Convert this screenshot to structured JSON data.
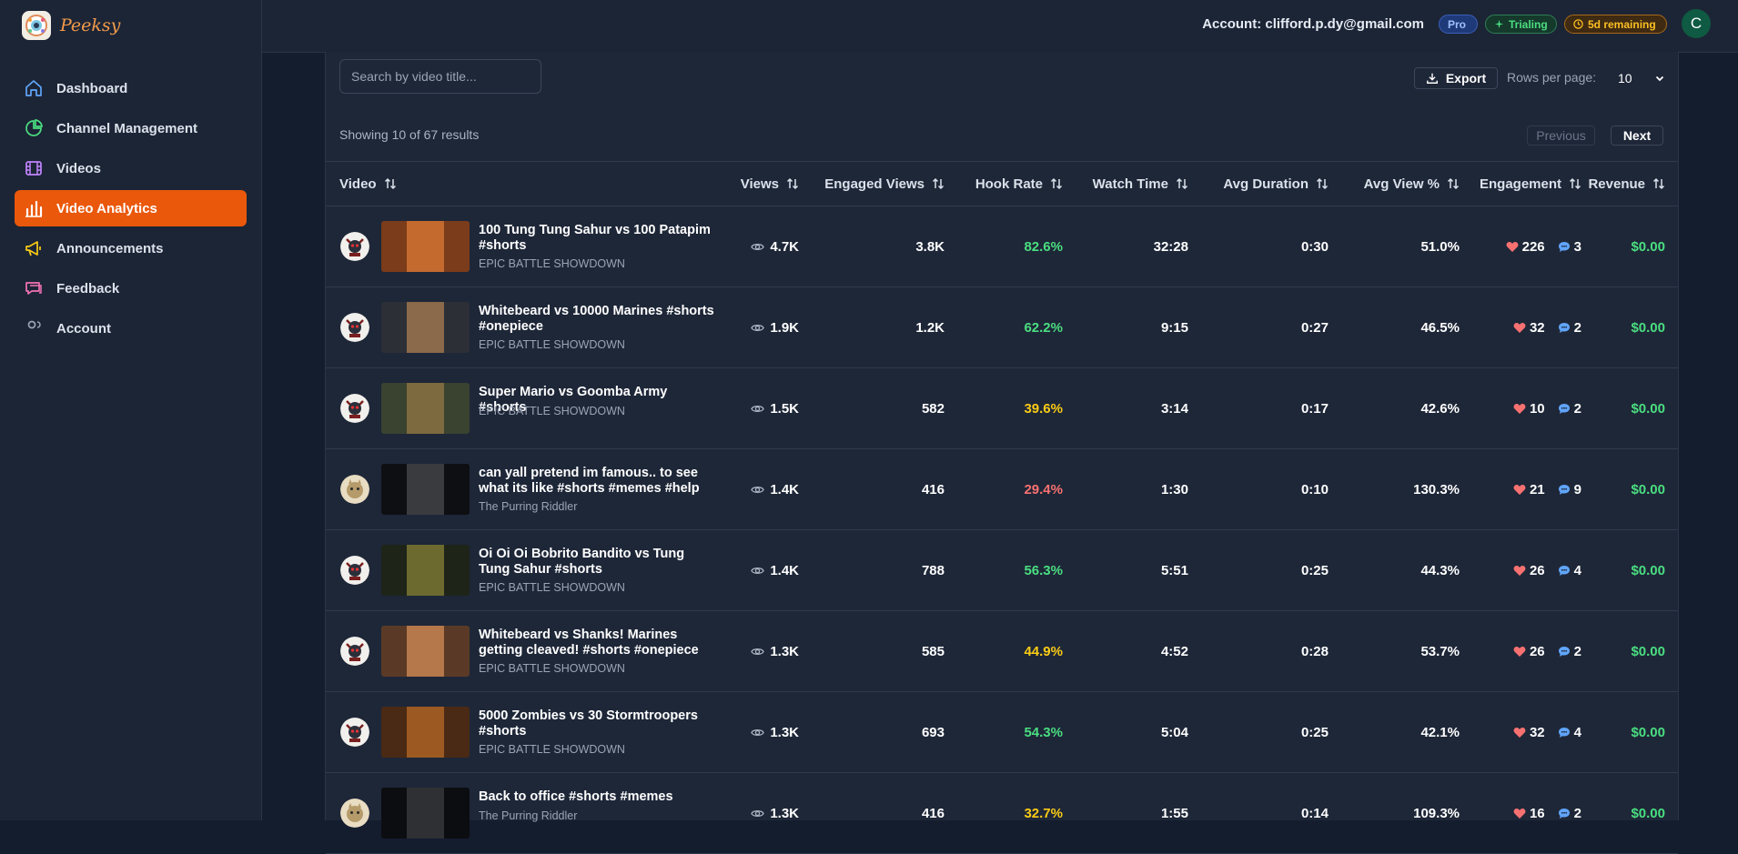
{
  "app": {
    "name": "Peeksy"
  },
  "sidebar": {
    "items": [
      {
        "label": "Dashboard",
        "icon": "home-icon",
        "color": "#60a5fa"
      },
      {
        "label": "Channel Management",
        "icon": "pie-chart-icon",
        "color": "#4ade80"
      },
      {
        "label": "Videos",
        "icon": "film-icon",
        "color": "#c084fc"
      },
      {
        "label": "Video Analytics",
        "icon": "bar-chart-icon",
        "color": "#ffffff",
        "active": true
      },
      {
        "label": "Announcements",
        "icon": "megaphone-icon",
        "color": "#facc15"
      },
      {
        "label": "Feedback",
        "icon": "message-icon",
        "color": "#f472b6"
      },
      {
        "label": "Account",
        "icon": "users-icon",
        "color": "#9aa4b5"
      }
    ]
  },
  "header": {
    "account": "Account: clifford.p.dy@gmail.com",
    "badges": {
      "pro": "Pro",
      "trialing": "Trialing",
      "remaining": "5d remaining"
    },
    "avatar_initial": "C"
  },
  "controls": {
    "search_placeholder": "Search by video title...",
    "export_label": "Export",
    "rows_per_page_label": "Rows per page:",
    "rows_per_page_value": "10",
    "showing": "Showing 10 of 67 results",
    "previous": "Previous",
    "next": "Next"
  },
  "table": {
    "columns": [
      "Video",
      "Views",
      "Engaged Views",
      "Hook Rate",
      "Watch Time",
      "Avg Duration",
      "Avg View %",
      "Engagement",
      "Revenue"
    ],
    "rows": [
      {
        "title": "100 Tung Tung Sahur vs 100 Patapim #shorts",
        "channel": "EPIC BATTLE SHOWDOWN",
        "views": "4.7K",
        "engaged": "3.8K",
        "hook": "82.6%",
        "hook_level": "green",
        "watch": "32:28",
        "avg_dur": "0:30",
        "avg_view": "51.0%",
        "likes": "226",
        "comments": "3",
        "revenue": "$0.00",
        "thumb": [
          "#7a3c1a",
          "#c46a2e"
        ]
      },
      {
        "title": "Whitebeard vs 10000 Marines #shorts #onepiece",
        "channel": "EPIC BATTLE SHOWDOWN",
        "views": "1.9K",
        "engaged": "1.2K",
        "hook": "62.2%",
        "hook_level": "green",
        "watch": "9:15",
        "avg_dur": "0:27",
        "avg_view": "46.5%",
        "likes": "32",
        "comments": "2",
        "revenue": "$0.00",
        "thumb": [
          "#2c2f36",
          "#8a6a4a"
        ]
      },
      {
        "title": "Super Mario vs Goomba Army #shorts",
        "channel": "EPIC BATTLE SHOWDOWN",
        "views": "1.5K",
        "engaged": "582",
        "hook": "39.6%",
        "hook_level": "yellow",
        "watch": "3:14",
        "avg_dur": "0:17",
        "avg_view": "42.6%",
        "likes": "10",
        "comments": "2",
        "revenue": "$0.00",
        "thumb": [
          "#3a4230",
          "#7d6a3f"
        ]
      },
      {
        "title": "can yall pretend im famous.. to see what its like #shorts #memes #help",
        "channel": "The Purring Riddler",
        "views": "1.4K",
        "engaged": "416",
        "hook": "29.4%",
        "hook_level": "red",
        "watch": "1:30",
        "avg_dur": "0:10",
        "avg_view": "130.3%",
        "likes": "21",
        "comments": "9",
        "revenue": "$0.00",
        "thumb": [
          "#0e0f12",
          "#3a3b3f"
        ]
      },
      {
        "title": "Oi Oi Oi Bobrito Bandito vs Tung Tung Sahur #shorts",
        "channel": "EPIC BATTLE SHOWDOWN",
        "views": "1.4K",
        "engaged": "788",
        "hook": "56.3%",
        "hook_level": "green",
        "watch": "5:51",
        "avg_dur": "0:25",
        "avg_view": "44.3%",
        "likes": "26",
        "comments": "4",
        "revenue": "$0.00",
        "thumb": [
          "#1e2418",
          "#6d6a30"
        ]
      },
      {
        "title": "Whitebeard vs Shanks! Marines getting cleaved! #shorts #onepiece",
        "channel": "EPIC BATTLE SHOWDOWN",
        "views": "1.3K",
        "engaged": "585",
        "hook": "44.9%",
        "hook_level": "yellow",
        "watch": "4:52",
        "avg_dur": "0:28",
        "avg_view": "53.7%",
        "likes": "26",
        "comments": "2",
        "revenue": "$0.00",
        "thumb": [
          "#5a3a26",
          "#b5784a"
        ]
      },
      {
        "title": "5000 Zombies vs 30 Stormtroopers #shorts",
        "channel": "EPIC BATTLE SHOWDOWN",
        "views": "1.3K",
        "engaged": "693",
        "hook": "54.3%",
        "hook_level": "green",
        "watch": "5:04",
        "avg_dur": "0:25",
        "avg_view": "42.1%",
        "likes": "32",
        "comments": "4",
        "revenue": "$0.00",
        "thumb": [
          "#4a2a14",
          "#9c5a22"
        ]
      },
      {
        "title": "Back to office #shorts #memes",
        "channel": "The Purring Riddler",
        "views": "1.3K",
        "engaged": "416",
        "hook": "32.7%",
        "hook_level": "yellow",
        "watch": "1:55",
        "avg_dur": "0:14",
        "avg_view": "109.3%",
        "likes": "16",
        "comments": "2",
        "revenue": "$0.00",
        "thumb": [
          "#0c0d10",
          "#2e3033"
        ]
      }
    ]
  }
}
